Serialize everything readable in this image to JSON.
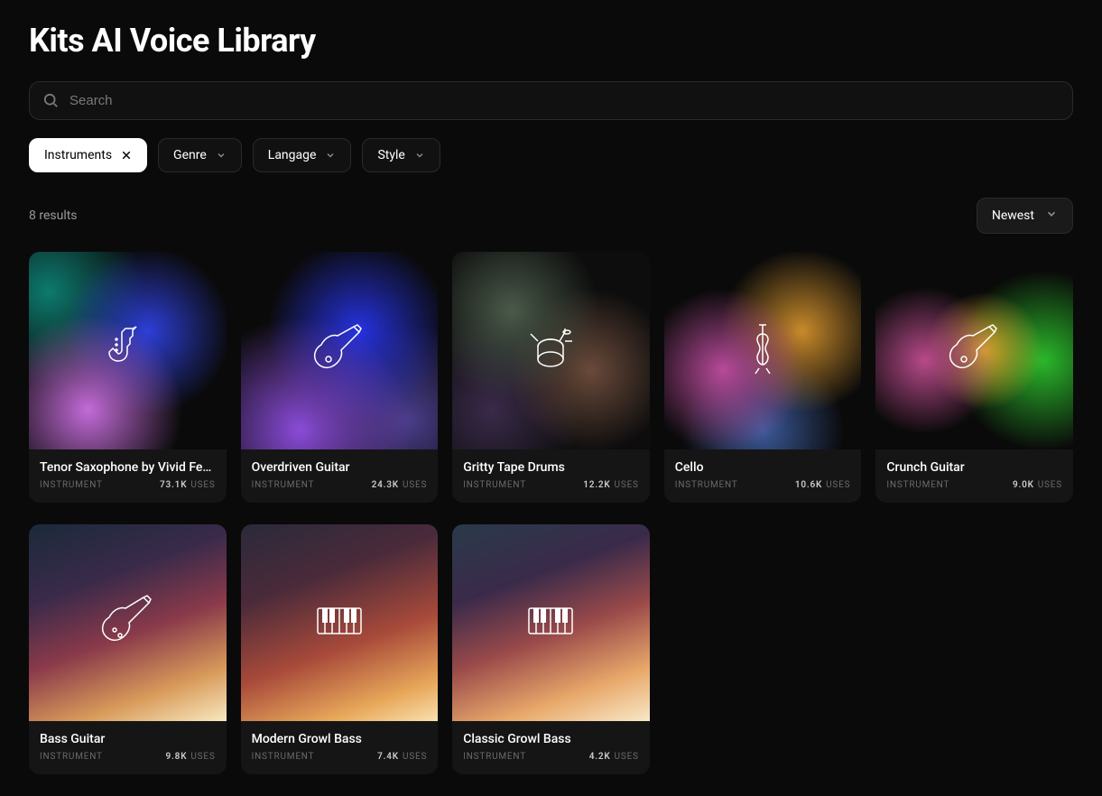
{
  "header": {
    "title": "Kits AI Voice Library"
  },
  "search": {
    "placeholder": "Search"
  },
  "filters": [
    {
      "label": "Instruments",
      "active": true,
      "close": true
    },
    {
      "label": "Genre",
      "active": false
    },
    {
      "label": "Langage",
      "active": false
    },
    {
      "label": "Style",
      "active": false
    }
  ],
  "results_count": "8 results",
  "sort": {
    "label": "Newest"
  },
  "cards": [
    {
      "title": "Tenor Saxophone by Vivid Feve...",
      "tag": "INSTRUMENT",
      "uses_count": "73.1K",
      "uses_label": "USES",
      "icon": "sax",
      "grad": "g0"
    },
    {
      "title": "Overdriven Guitar",
      "tag": "INSTRUMENT",
      "uses_count": "24.3K",
      "uses_label": "USES",
      "icon": "guitar",
      "grad": "g1"
    },
    {
      "title": "Gritty Tape Drums",
      "tag": "INSTRUMENT",
      "uses_count": "12.2K",
      "uses_label": "USES",
      "icon": "drums",
      "grad": "g2"
    },
    {
      "title": "Cello",
      "tag": "INSTRUMENT",
      "uses_count": "10.6K",
      "uses_label": "USES",
      "icon": "cello",
      "grad": "g3"
    },
    {
      "title": "Crunch Guitar",
      "tag": "INSTRUMENT",
      "uses_count": "9.0K",
      "uses_label": "USES",
      "icon": "guitar",
      "grad": "g4"
    },
    {
      "title": "Bass Guitar",
      "tag": "INSTRUMENT",
      "uses_count": "9.8K",
      "uses_label": "USES",
      "icon": "bass",
      "grad": "g5"
    },
    {
      "title": "Modern Growl Bass",
      "tag": "INSTRUMENT",
      "uses_count": "7.4K",
      "uses_label": "USES",
      "icon": "keys",
      "grad": "g6"
    },
    {
      "title": "Classic Growl Bass",
      "tag": "INSTRUMENT",
      "uses_count": "4.2K",
      "uses_label": "USES",
      "icon": "keys",
      "grad": "g7"
    }
  ]
}
